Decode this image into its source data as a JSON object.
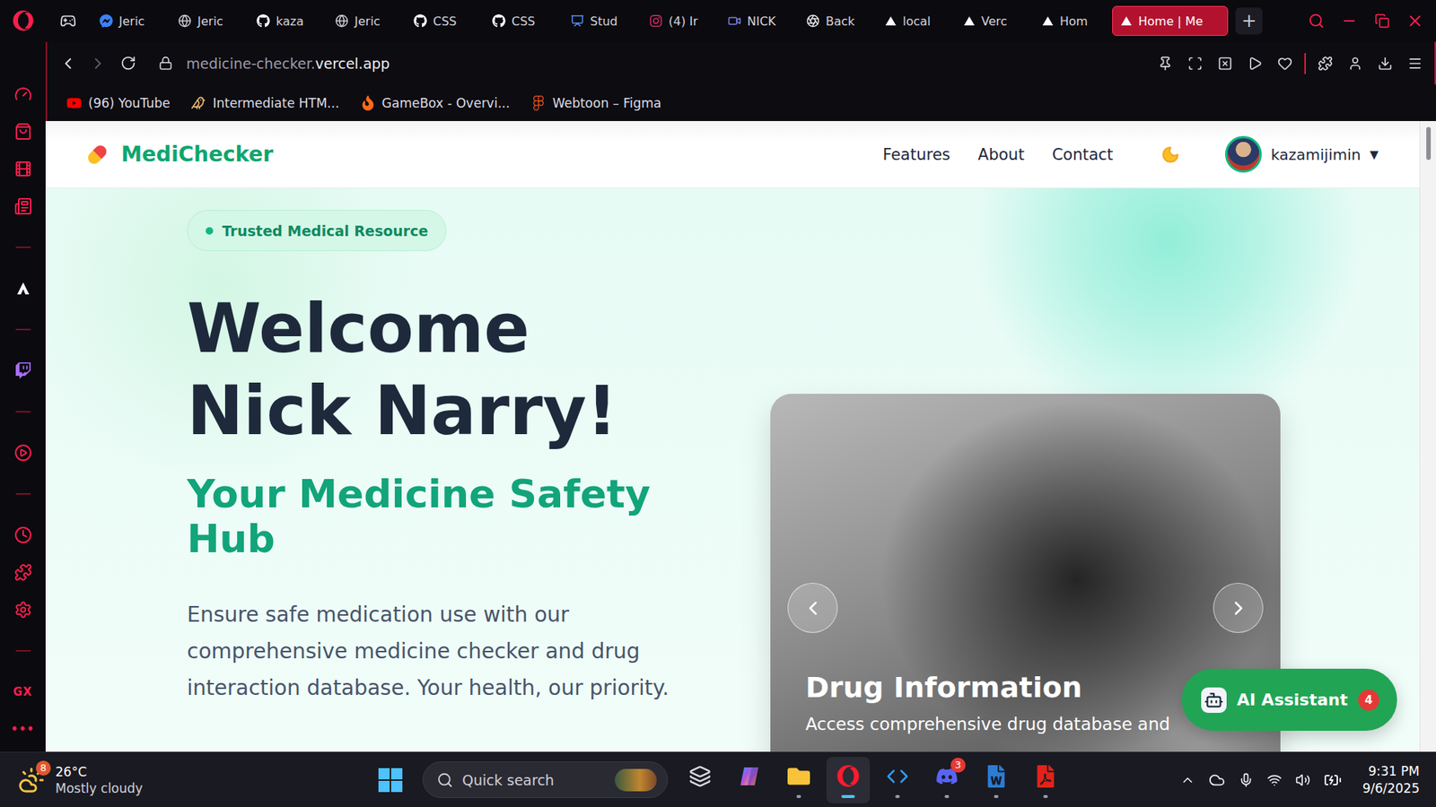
{
  "browser": {
    "tabs": [
      {
        "label": "Jeric",
        "kind": "messenger",
        "selected": false
      },
      {
        "label": "Jeric",
        "kind": "globe",
        "selected": false
      },
      {
        "label": "kaza",
        "kind": "github",
        "selected": false
      },
      {
        "label": "Jeric",
        "kind": "globe",
        "selected": false
      },
      {
        "label": "CSS",
        "kind": "github",
        "selected": false
      },
      {
        "label": "CSS",
        "kind": "github",
        "selected": false
      },
      {
        "label": "Stud",
        "kind": "classroom",
        "selected": false
      },
      {
        "label": "(4) Ir",
        "kind": "instagram",
        "selected": false
      },
      {
        "label": "NICK",
        "kind": "teams",
        "selected": false
      },
      {
        "label": "Back",
        "kind": "chatgpt",
        "selected": false
      },
      {
        "label": "local",
        "kind": "vercel",
        "selected": false
      },
      {
        "label": "Verc",
        "kind": "vercel",
        "selected": false
      },
      {
        "label": "Hom",
        "kind": "vercel",
        "selected": false
      },
      {
        "label": "Home | Me",
        "kind": "vercel",
        "selected": true
      }
    ],
    "new_tab": "+",
    "address": {
      "prefix": "medicine-checker.",
      "domain": "vercel.app"
    },
    "back_enabled": true,
    "forward_enabled": false,
    "bookmarks": [
      {
        "label": "(96) YouTube",
        "kind": "youtube"
      },
      {
        "label": "Intermediate HTM...",
        "kind": "owl"
      },
      {
        "label": "GameBox - Overvi...",
        "kind": "fire"
      },
      {
        "label": "Webtoon – Figma",
        "kind": "figma"
      }
    ],
    "sidebar": {
      "gx": "GX",
      "more": "•••"
    }
  },
  "page": {
    "logo": "MediChecker",
    "nav": [
      "Features",
      "About",
      "Contact"
    ],
    "user": {
      "name": "kazamijimin",
      "caret": "▼"
    },
    "hero": {
      "badge": "Trusted Medical Resource",
      "title": "Welcome Nick Narry!",
      "subtitle": "Your Medicine Safety Hub",
      "description": "Ensure safe medication use with our comprehensive medicine checker and drug interaction database. Your health, our priority."
    },
    "carousel": {
      "title": "Drug Information",
      "text": "Access comprehensive drug database and"
    },
    "assistant": {
      "label": "AI Assistant",
      "badge": "4"
    }
  },
  "taskbar": {
    "weather": {
      "badge": "8",
      "temp": "26°C",
      "condition": "Mostly cloudy"
    },
    "search": {
      "placeholder": "Quick search"
    },
    "apps": [
      {
        "kind": "taskview",
        "running": false,
        "active": false
      },
      {
        "kind": "copilot",
        "running": false,
        "active": false
      },
      {
        "kind": "explorer",
        "running": true,
        "active": false
      },
      {
        "kind": "opera",
        "running": true,
        "active": true
      },
      {
        "kind": "vscode",
        "running": true,
        "active": false
      },
      {
        "kind": "discord",
        "running": true,
        "active": false,
        "badge": "3"
      },
      {
        "kind": "word",
        "running": true,
        "active": false
      },
      {
        "kind": "acrobat",
        "running": true,
        "active": false
      }
    ],
    "clock": {
      "time": "9:31 PM",
      "date": "9/6/2025"
    }
  }
}
